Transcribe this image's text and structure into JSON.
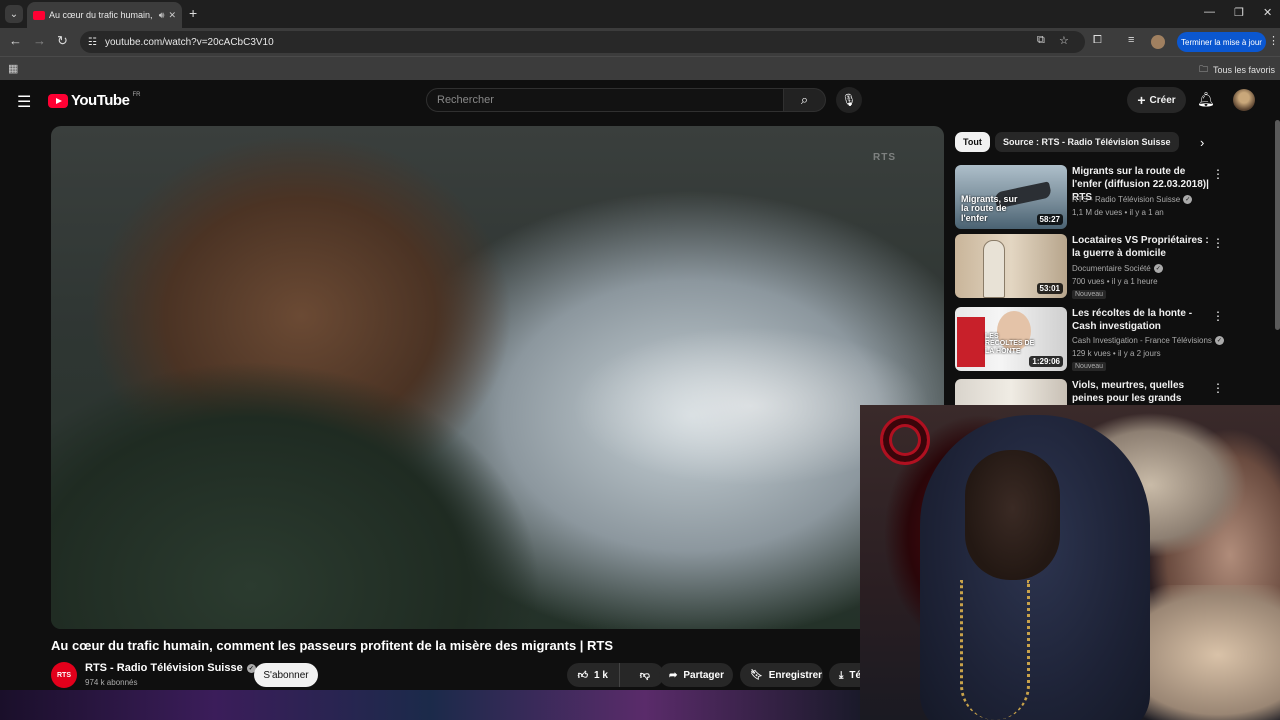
{
  "browser": {
    "tab_title": "Au cœur du trafic humain, c",
    "url": "youtube.com/watch?v=20cACbC3V10",
    "update_button": "Terminer la mise à jour",
    "bookmarks_label": "Tous les favoris"
  },
  "yt": {
    "logo_text": "YouTube",
    "country": "FR",
    "search_placeholder": "Rechercher",
    "create_label": "Créer"
  },
  "video": {
    "watermark": "RTS",
    "title": "Au cœur du trafic humain, comment les passeurs profitent de la misère des migrants | RTS",
    "channel_avatar_text": "RTS",
    "channel_name": "RTS - Radio Télévision Suisse",
    "subscribers": "974 k abonnés",
    "subscribe_label": "S'abonner",
    "likes": "1 k",
    "share_label": "Partager",
    "save_label": "Enregistrer",
    "download_label": "Té"
  },
  "chips": {
    "all": "Tout",
    "source": "Source : RTS - Radio Télévision Suisse"
  },
  "recommendations": [
    {
      "title": "Migrants sur la route de l'enfer (diffusion 22.03.2018)| RTS",
      "channel": "RTS - Radio Télévision Suisse",
      "meta": "1,1 M de vues • il y a 1 an",
      "duration": "58:27",
      "thumb_text": "Migrants, sur la route de l'enfer",
      "badge": ""
    },
    {
      "title": "Locataires VS Propriétaires : la guerre à domicile",
      "channel": "Documentaire Société",
      "meta": "700 vues • il y a 1 heure",
      "duration": "53:01",
      "thumb_text": "",
      "badge": "Nouveau"
    },
    {
      "title": "Les récoltes de la honte - Cash investigation",
      "channel": "Cash Investigation - France Télévisions",
      "meta": "129 k vues • il y a 2 jours",
      "duration": "1:29:06",
      "thumb_text": "LES RÉCOLTES DE LA HONTE",
      "badge": "Nouveau"
    },
    {
      "title": "Viols, meurtres, quelles peines pour les grands assassins? | ...",
      "channel": "",
      "meta": "",
      "duration": "",
      "thumb_text": "",
      "badge": ""
    }
  ]
}
